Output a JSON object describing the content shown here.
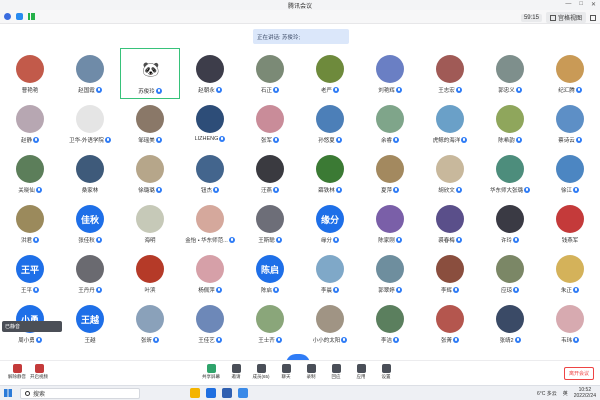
{
  "window": {
    "title": "腾讯会议",
    "controls": [
      "—",
      "□",
      "✕"
    ]
  },
  "statusbar": {
    "time": "59:15",
    "view_label": "宫格视图"
  },
  "speaking": {
    "text": "正在讲话: 苏俊玲;"
  },
  "participants": [
    {
      "name": "曹艳艳",
      "color": "#c25a4a",
      "text": "",
      "mic": false
    },
    {
      "name": "赵国霞",
      "color": "#6f8ba8",
      "text": "",
      "mic": true
    },
    {
      "name": "苏俊玲",
      "color": "#ffffff",
      "text": "🐼",
      "mic": true
    },
    {
      "name": "赵朝永",
      "color": "#3d3d4a",
      "text": "",
      "mic": true
    },
    {
      "name": "石正",
      "color": "#7b8a76",
      "text": "",
      "mic": true
    },
    {
      "name": "老严",
      "color": "#6e8a3c",
      "text": "",
      "mic": true
    },
    {
      "name": "刘艳辉",
      "color": "#6a7fc4",
      "text": "",
      "mic": true
    },
    {
      "name": "王志宏",
      "color": "#a05a56",
      "text": "",
      "mic": true
    },
    {
      "name": "郭忠义",
      "color": "#7e8f8c",
      "text": "",
      "mic": true
    },
    {
      "name": "纪汇腾",
      "color": "#c99a56",
      "text": "",
      "mic": true
    },
    {
      "name": "赵静",
      "color": "#b7a7b2",
      "text": "",
      "mic": true
    },
    {
      "name": "卫华-外语学院",
      "color": "#e5e5e5",
      "text": "",
      "mic": true
    },
    {
      "name": "邹瑶美",
      "color": "#8a7868",
      "text": "",
      "mic": true
    },
    {
      "name": "LIZHENG",
      "color": "#2d4d78",
      "text": "",
      "mic": true
    },
    {
      "name": "张军",
      "color": "#c98c99",
      "text": "",
      "mic": true
    },
    {
      "name": "孙悠夏",
      "color": "#4c7fb8",
      "text": "",
      "mic": true
    },
    {
      "name": "余睿",
      "color": "#7fa58a",
      "text": "",
      "mic": true
    },
    {
      "name": "虎鲸的海洋",
      "color": "#6aa0c8",
      "text": "",
      "mic": true
    },
    {
      "name": "陈希韵",
      "color": "#8fa65c",
      "text": "",
      "mic": true
    },
    {
      "name": "蔡诗云",
      "color": "#5d8fc6",
      "text": "",
      "mic": true
    },
    {
      "name": "关晓仙",
      "color": "#5c7e5a",
      "text": "",
      "mic": true
    },
    {
      "name": "桑家林",
      "color": "#3e5a7a",
      "text": "",
      "mic": false
    },
    {
      "name": "徐璐璐",
      "color": "#b6a68a",
      "text": "",
      "mic": true
    },
    {
      "name": "钮杰",
      "color": "#43658d",
      "text": "",
      "mic": true
    },
    {
      "name": "汪燕",
      "color": "#3a3a40",
      "text": "",
      "mic": true
    },
    {
      "name": "薛铁林",
      "color": "#3b7a34",
      "text": "",
      "mic": true
    },
    {
      "name": "夏萍",
      "color": "#a3895f",
      "text": "",
      "mic": true
    },
    {
      "name": "胡欣文",
      "color": "#c8b89c",
      "text": "",
      "mic": true
    },
    {
      "name": "华东师大张璐",
      "color": "#4d8d7c",
      "text": "",
      "mic": true
    },
    {
      "name": "徐江",
      "color": "#4c86c2",
      "text": "",
      "mic": true
    },
    {
      "name": "洪君",
      "color": "#9b8a5c",
      "text": "",
      "mic": true
    },
    {
      "name": "张佳秋",
      "color": "#1e6fe8",
      "text": "佳秋",
      "mic": true
    },
    {
      "name": "海明",
      "color": "#c6c9b8",
      "text": "",
      "mic": false
    },
    {
      "name": "金怡 • 华东师范...",
      "color": "#d5a89c",
      "text": "",
      "mic": true
    },
    {
      "name": "王斯聪",
      "color": "#6d6e78",
      "text": "",
      "mic": true
    },
    {
      "name": "缘分",
      "color": "#1e6fe8",
      "text": "缘分",
      "mic": true
    },
    {
      "name": "陈家刚",
      "color": "#7a5fa8",
      "text": "",
      "mic": true
    },
    {
      "name": "裘春梅",
      "color": "#5a4f8a",
      "text": "",
      "mic": true
    },
    {
      "name": "许玲",
      "color": "#3a3a44",
      "text": "",
      "mic": true
    },
    {
      "name": "钱燕军",
      "color": "#c43a3a",
      "text": "",
      "mic": false
    },
    {
      "name": "王平",
      "color": "#1e6fe8",
      "text": "王平",
      "mic": true
    },
    {
      "name": "王丹丹",
      "color": "#6a6a70",
      "text": "",
      "mic": true
    },
    {
      "name": "叶滨",
      "color": "#b53a28",
      "text": "",
      "mic": false
    },
    {
      "name": "杨佩萍",
      "color": "#d6a0a8",
      "text": "",
      "mic": true
    },
    {
      "name": "陈启",
      "color": "#1e6fe8",
      "text": "陈启",
      "mic": true
    },
    {
      "name": "李晨",
      "color": "#7fa8c8",
      "text": "",
      "mic": true
    },
    {
      "name": "郭翠婷",
      "color": "#6e8e9e",
      "text": "",
      "mic": true
    },
    {
      "name": "李辉",
      "color": "#8a4e3e",
      "text": "",
      "mic": true
    },
    {
      "name": "应琼",
      "color": "#7b8766",
      "text": "",
      "mic": true
    },
    {
      "name": "朱正",
      "color": "#d4b25a",
      "text": "",
      "mic": true
    },
    {
      "name": "周小勇",
      "color": "#1e6fe8",
      "text": "小勇",
      "mic": true
    },
    {
      "name": "王越",
      "color": "#1e6fe8",
      "text": "王越",
      "mic": false
    },
    {
      "name": "张昕",
      "color": "#8aa1ba",
      "text": "",
      "mic": true
    },
    {
      "name": "王佳艺",
      "color": "#6d88b8",
      "text": "",
      "mic": true
    },
    {
      "name": "王士齐",
      "color": "#8aa67a",
      "text": "",
      "mic": true
    },
    {
      "name": "小小的太阳",
      "color": "#a09484",
      "text": "",
      "mic": true
    },
    {
      "name": "李洁",
      "color": "#5b7f5e",
      "text": "",
      "mic": true
    },
    {
      "name": "张菁",
      "color": "#b4564e",
      "text": "",
      "mic": true
    },
    {
      "name": "张靖2",
      "color": "#3a4a66",
      "text": "",
      "mic": true
    },
    {
      "name": "韦玮",
      "color": "#d7aab0",
      "text": "",
      "mic": true
    }
  ],
  "sidectl": {
    "label": "已静音"
  },
  "toolbar": {
    "left": [
      {
        "label": "解除静音",
        "icon": "mic-icon"
      },
      {
        "label": "开启视频",
        "icon": "video-icon"
      }
    ],
    "center": [
      {
        "label": "共享屏幕",
        "icon": "share-screen-icon"
      },
      {
        "label": "邀请",
        "icon": "invite-icon"
      },
      {
        "label": "成员(65)",
        "icon": "members-icon"
      },
      {
        "label": "聊天",
        "icon": "chat-icon"
      },
      {
        "label": "录制",
        "icon": "record-icon"
      },
      {
        "label": "回应",
        "icon": "reaction-icon"
      },
      {
        "label": "应用",
        "icon": "apps-icon"
      },
      {
        "label": "设置",
        "icon": "settings-icon"
      }
    ],
    "leave_label": "离开会议"
  },
  "taskbar": {
    "search_placeholder": "搜索",
    "weather": "6°C 多云",
    "time": "10:52",
    "date": "2022/2/24",
    "lang": "英"
  },
  "colors": {
    "accent": "#2f7cf6",
    "danger": "#e44444",
    "selected_border": "#37c27a"
  }
}
